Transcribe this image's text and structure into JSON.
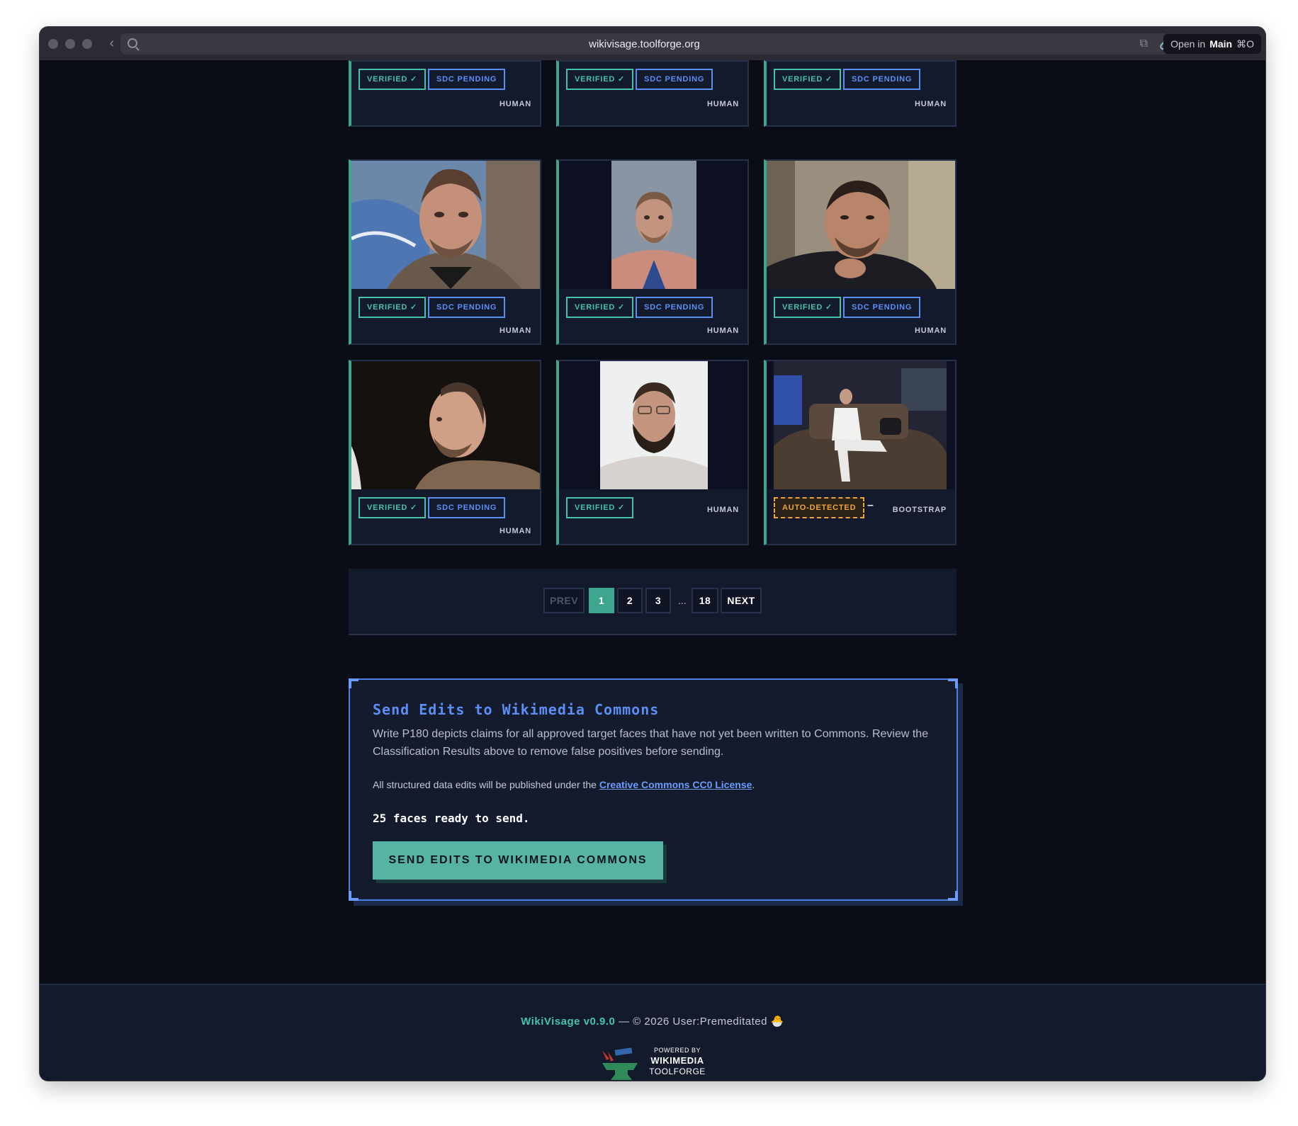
{
  "browser": {
    "url": "wikivisage.toolforge.org",
    "open_in_prefix": "Open in",
    "open_in_target": "Main",
    "open_in_shortcut": "⌘O"
  },
  "grid": {
    "top_row": [
      {
        "verified": "VERIFIED ✓",
        "sdc": "SDC PENDING",
        "species": "HUMAN"
      },
      {
        "verified": "VERIFIED ✓",
        "sdc": "SDC PENDING",
        "species": "HUMAN"
      },
      {
        "verified": "VERIFIED ✓",
        "sdc": "SDC PENDING",
        "species": "HUMAN"
      }
    ],
    "middle_row": [
      {
        "verified": "VERIFIED ✓",
        "sdc": "SDC PENDING",
        "species": "HUMAN"
      },
      {
        "verified": "VERIFIED ✓",
        "sdc": "SDC PENDING",
        "species": "HUMAN"
      },
      {
        "verified": "VERIFIED ✓",
        "sdc": "SDC PENDING",
        "species": "HUMAN"
      }
    ],
    "bottom_row": [
      {
        "verified": "VERIFIED ✓",
        "sdc": "SDC PENDING",
        "species": "HUMAN"
      },
      {
        "verified": "VERIFIED ✓",
        "species": "HUMAN"
      },
      {
        "auto": "AUTO-DETECTED",
        "dash": "–",
        "species": "BOOTSTRAP"
      }
    ]
  },
  "pagination": {
    "prev": "PREV",
    "pages": [
      "1",
      "2",
      "3"
    ],
    "ellipsis": "...",
    "last": "18",
    "next": "NEXT",
    "current": "1"
  },
  "send_panel": {
    "title": "Send Edits to Wikimedia Commons",
    "description": "Write P180 depicts claims for all approved target faces that have not yet been written to Commons. Review the Classification Results above to remove false positives before sending.",
    "license_prefix": "All structured data edits will be published under the ",
    "license_link": "Creative Commons CC0 License",
    "license_suffix": ".",
    "ready_text": "25 faces ready to send.",
    "button_label": "SEND EDITS TO WIKIMEDIA COMMONS"
  },
  "footer": {
    "brand": "WikiVisage v0.9.0",
    "copyright": " — © 2026 User:Premeditated ",
    "emoji": "🐣",
    "powered_by": "POWERED BY",
    "wikimedia": "WIKIMEDIA",
    "toolforge": "TOOLFORGE"
  },
  "colors": {
    "accent_teal": "#3ea58f",
    "accent_blue": "#5b8ff5",
    "warning_orange": "#f0a43a",
    "background": "#0a0d16"
  }
}
